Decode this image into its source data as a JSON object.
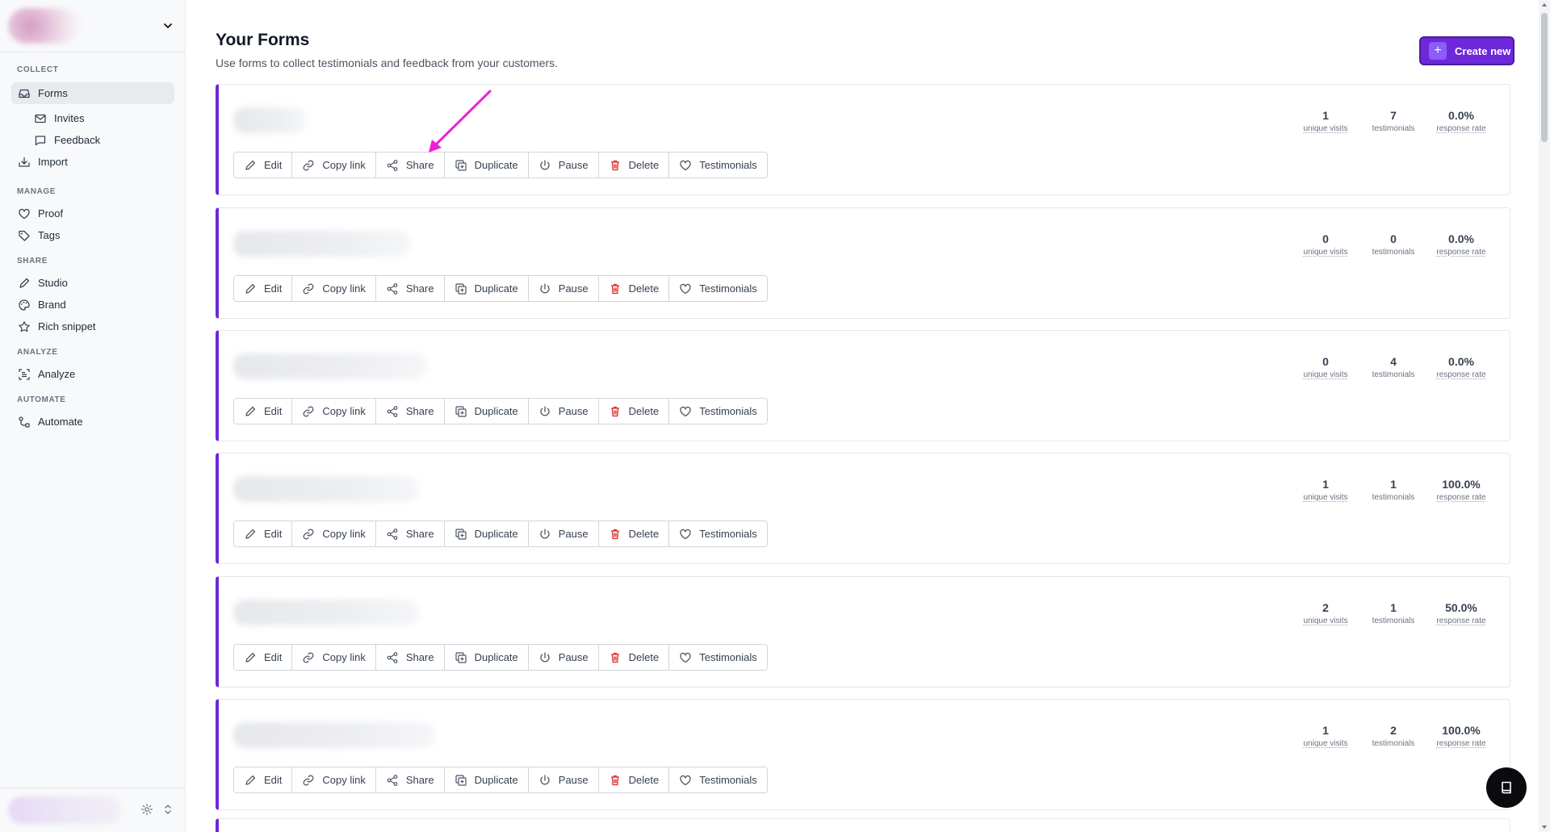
{
  "sidebar": {
    "sections": [
      {
        "title": "COLLECT"
      },
      {
        "title": "MANAGE"
      },
      {
        "title": "SHARE"
      },
      {
        "title": "ANALYZE"
      },
      {
        "title": "AUTOMATE"
      }
    ],
    "items": {
      "forms": "Forms",
      "invites": "Invites",
      "feedback": "Feedback",
      "import": "Import",
      "proof": "Proof",
      "tags": "Tags",
      "studio": "Studio",
      "brand": "Brand",
      "rich_snippet": "Rich snippet",
      "analyze": "Analyze",
      "automate": "Automate"
    }
  },
  "header": {
    "title": "Your Forms",
    "subtitle": "Use forms to collect testimonials and feedback from your customers.",
    "create_label": "Create new"
  },
  "actions": {
    "edit": "Edit",
    "copy_link": "Copy link",
    "share": "Share",
    "duplicate": "Duplicate",
    "pause": "Pause",
    "delete": "Delete",
    "testimonials": "Testimonials"
  },
  "stat_labels": {
    "visits": "unique visits",
    "testimonials": "testimonials",
    "rate": "response rate"
  },
  "forms": [
    {
      "visits": "1",
      "testimonials": "7",
      "rate": "0.0%"
    },
    {
      "visits": "0",
      "testimonials": "0",
      "rate": "0.0%"
    },
    {
      "visits": "0",
      "testimonials": "4",
      "rate": "0.0%"
    },
    {
      "visits": "1",
      "testimonials": "1",
      "rate": "100.0%"
    },
    {
      "visits": "2",
      "testimonials": "1",
      "rate": "50.0%"
    },
    {
      "visits": "1",
      "testimonials": "2",
      "rate": "100.0%"
    }
  ],
  "colors": {
    "accent": "#6d28d9",
    "annotation_arrow": "#f01fd8",
    "delete_icon": "#dc2626"
  }
}
